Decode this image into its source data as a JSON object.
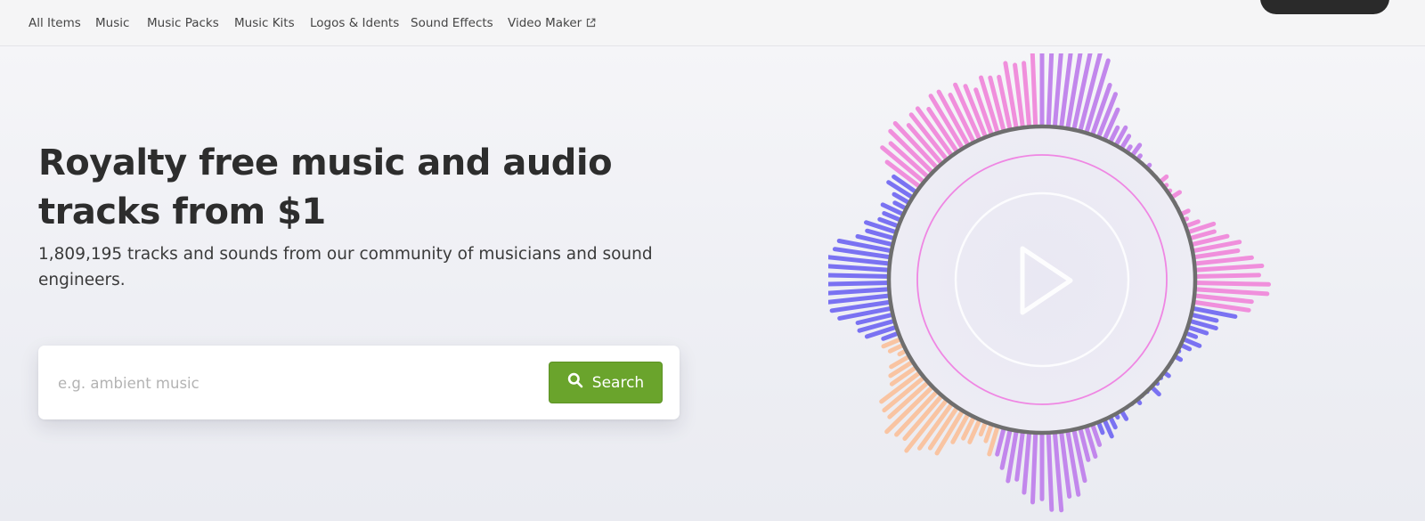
{
  "nav": {
    "items": [
      {
        "label": "All Items"
      },
      {
        "label": "Music"
      },
      {
        "label": "Music Packs"
      },
      {
        "label": "Music Kits"
      },
      {
        "label": "Logos & Idents"
      },
      {
        "label": "Sound Effects"
      },
      {
        "label": "Video Maker",
        "icon": "external-link-icon"
      }
    ]
  },
  "hero": {
    "title_line1": "Royalty free music and audio",
    "title_line2": "tracks from $1",
    "subtitle_line1": "1,809,195 tracks and sounds from our community of musicians and sound",
    "subtitle_line2": "engineers."
  },
  "search": {
    "placeholder": "e.g. ambient music",
    "value": "",
    "button_label": "Search",
    "button_icon": "search-icon"
  },
  "visualizer": {
    "icon": "play-icon"
  },
  "colors": {
    "accent_green": "#6aa42c",
    "viz_blue": "#7a72f2",
    "viz_pink": "#f08fdc",
    "viz_purple": "#c287ec",
    "viz_peach": "#f9c4a2",
    "ring_gray": "#6e6e6e"
  }
}
